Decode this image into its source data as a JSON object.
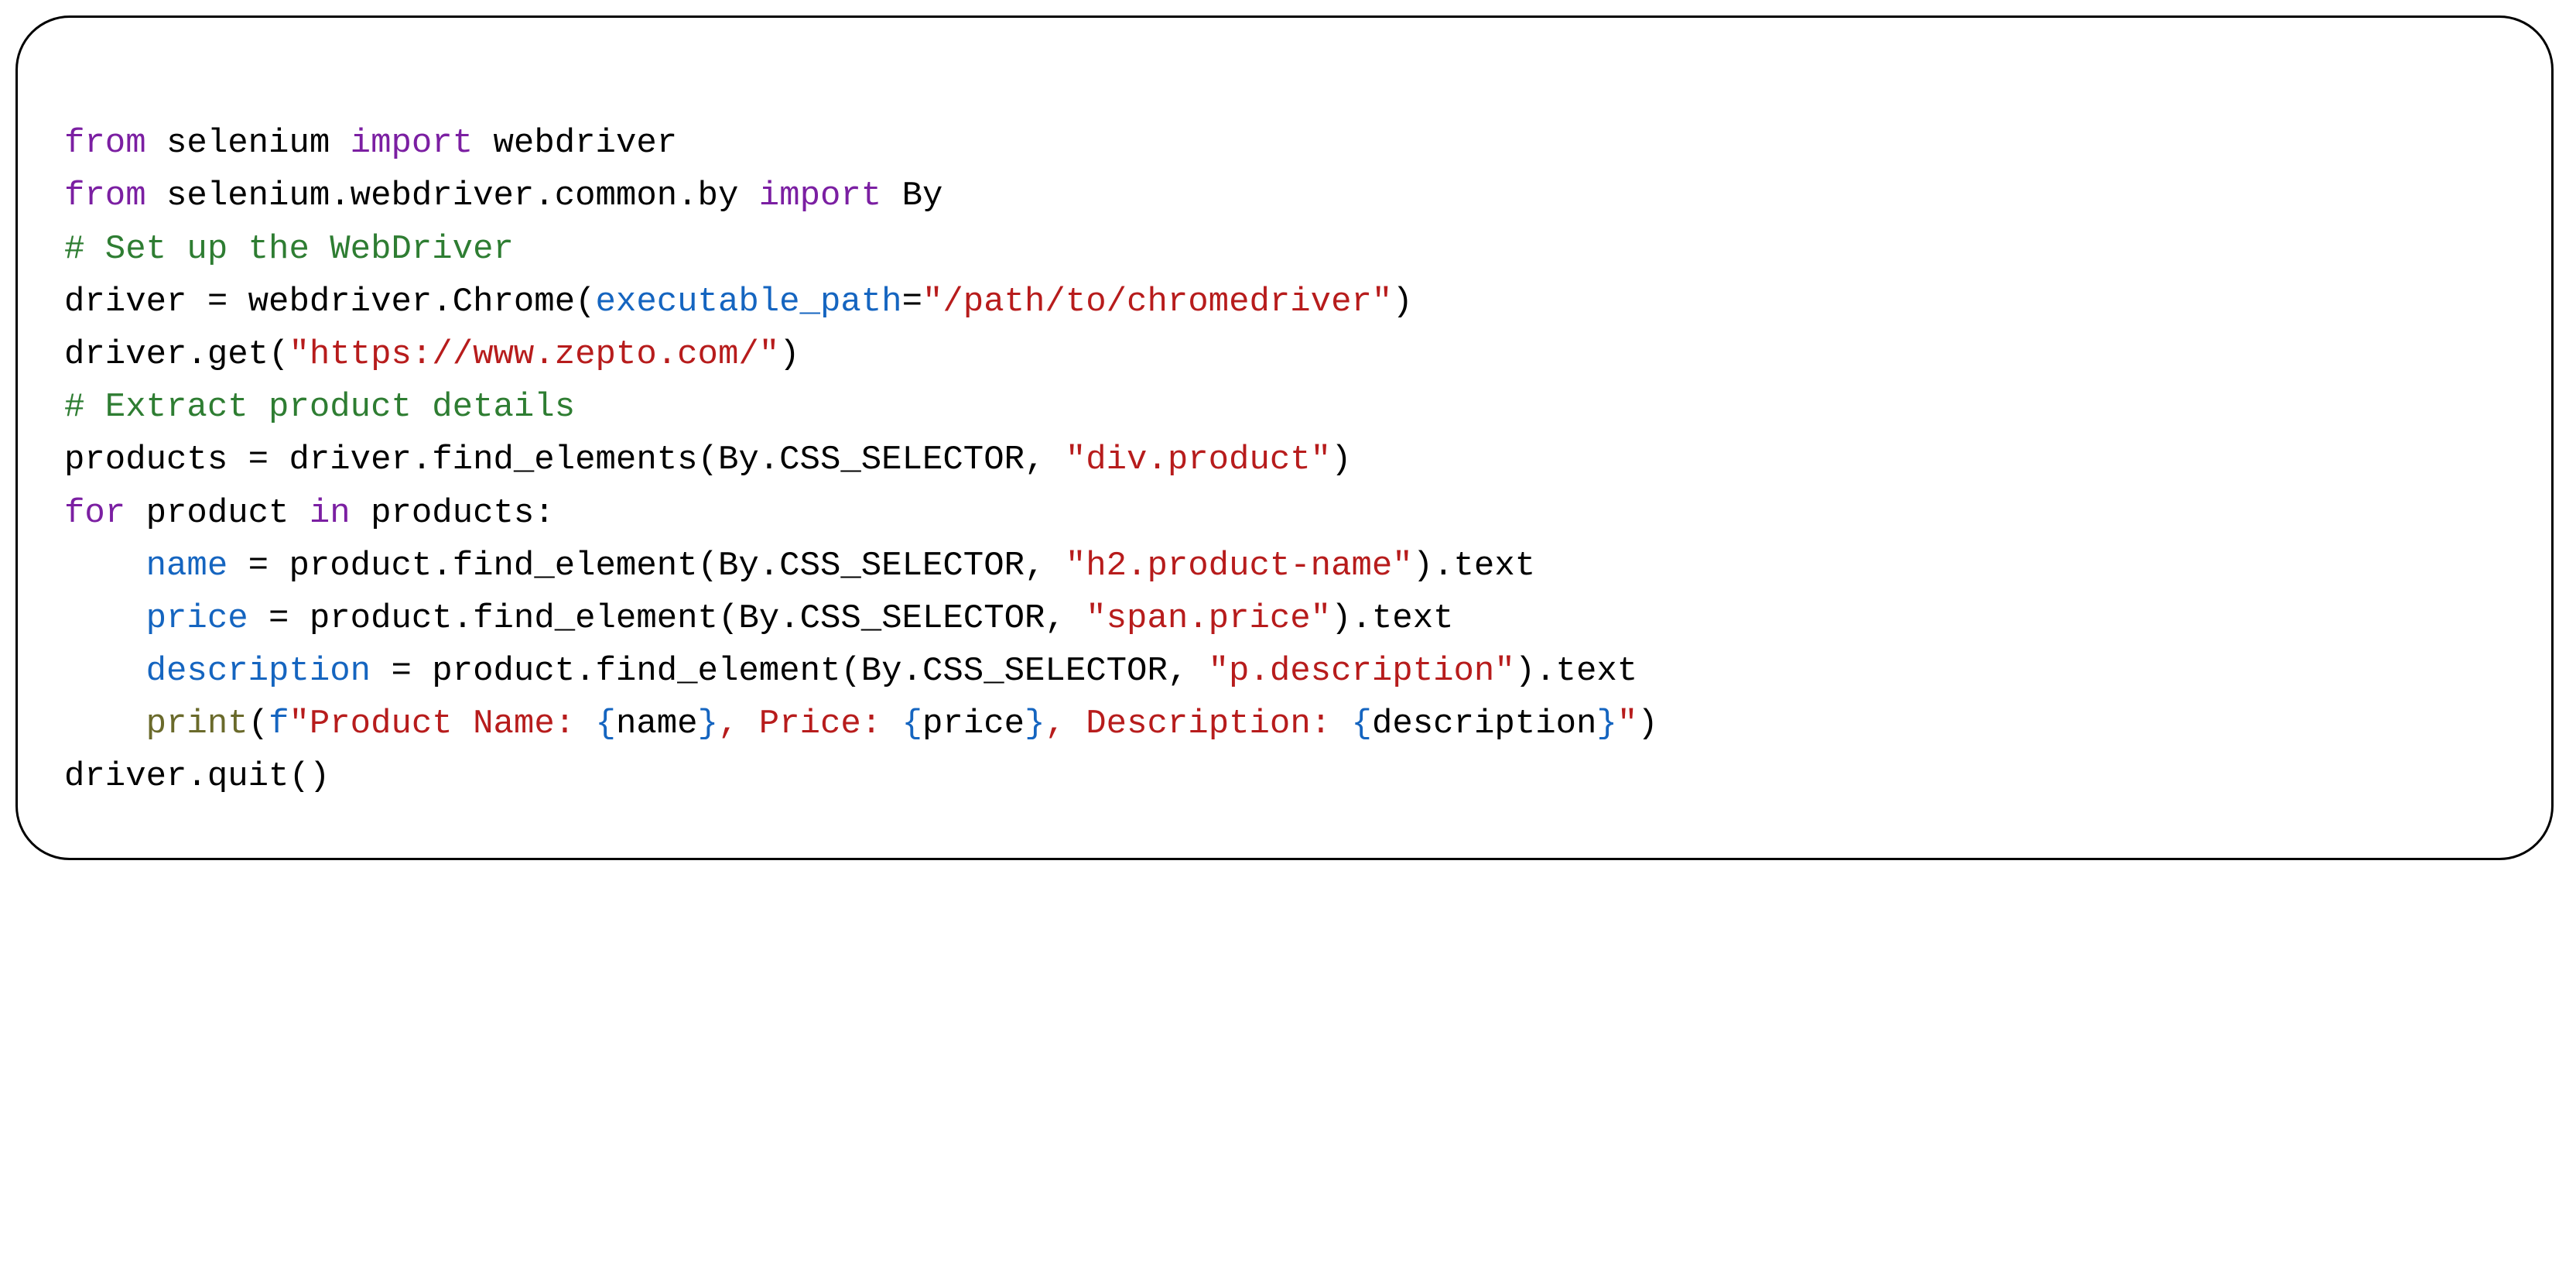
{
  "code": {
    "l1": {
      "kw1": "from",
      "mod1": " selenium ",
      "kw2": "import",
      "mod2": " webdriver"
    },
    "l2": {
      "kw1": "from",
      "mod1": " selenium.webdriver.common.by ",
      "kw2": "import",
      "mod2": " By"
    },
    "l3": {
      "cmt": "# Set up the WebDriver"
    },
    "l4": {
      "lhs": "driver = webdriver.Chrome(",
      "param": "executable_path",
      "eq": "=",
      "str": "\"/path/to/chromedriver\"",
      "rp": ")"
    },
    "l5": {
      "pre": "driver.get(",
      "str": "\"https://www.zepto.com/\"",
      "post": ")"
    },
    "l6": {
      "cmt": "# Extract product details"
    },
    "l7": {
      "pre": "products = driver.find_elements(By.CSS_SELECTOR, ",
      "str": "\"div.product\"",
      "post": ")"
    },
    "l8": {
      "kw1": "for",
      "mid": " product ",
      "kw2": "in",
      "post": " products:"
    },
    "l9": {
      "lhs": "name",
      "mid": " = product.find_element(By.CSS_SELECTOR, ",
      "str": "\"h2.product-name\"",
      "post": ").text"
    },
    "l10": {
      "lhs": "price",
      "mid": " = product.find_element(By.CSS_SELECTOR, ",
      "str": "\"span.price\"",
      "post": ").text"
    },
    "l11": {
      "lhs": "description",
      "mid": " = product.find_element(By.CSS_SELECTOR, ",
      "str": "\"p.description\"",
      "post": ").text"
    },
    "l12": {
      "call": "print",
      "lp": "(",
      "f": "f",
      "q1": "\"",
      "t1": "Product Name: ",
      "b1o": "{",
      "e1": "name",
      "b1c": "}",
      "t2": ", Price: ",
      "b2o": "{",
      "e2": "price",
      "b2c": "}",
      "t3": ", Description: ",
      "b3o": "{",
      "e3": "description",
      "b3c": "}",
      "q2": "\"",
      "rp": ")"
    },
    "l13": {
      "txt": "driver.quit()"
    }
  }
}
